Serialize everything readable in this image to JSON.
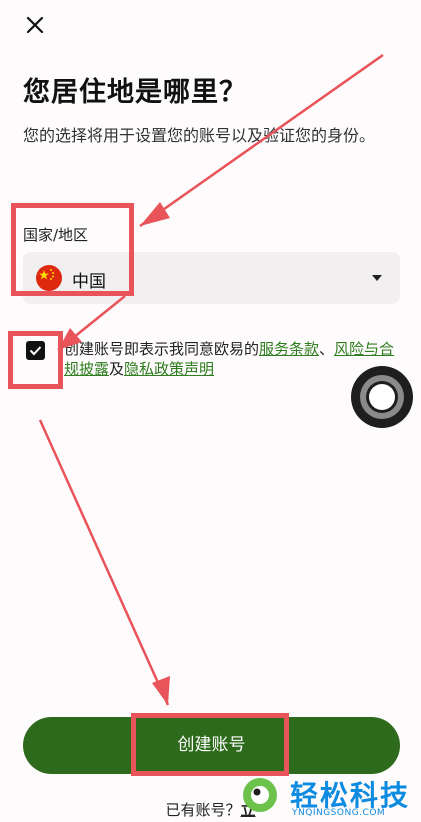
{
  "header": {
    "close_icon": "close-icon"
  },
  "title": "您居住地是哪里？",
  "subtitle": "您的选择将用于设置您的账号以及验证您的身份。",
  "country": {
    "label": "国家/地区",
    "selected": "中国",
    "flag_icon": "china-flag-icon",
    "dropdown_icon": "caret-down-icon"
  },
  "terms": {
    "checked": true,
    "prefix": "创建账号即表示我同意欧易的",
    "link_terms": "服务条款",
    "sep1": "、",
    "link_risk": "风险与合规披露",
    "sep2": "及",
    "link_privacy": "隐私政策声明"
  },
  "create_button": "创建账号",
  "login": {
    "prompt": "已有账号？",
    "link": "立"
  },
  "watermark": {
    "text": "轻松科技",
    "url": "YNQINGSONG.COM"
  },
  "colors": {
    "accent": "#2d6a1b",
    "link": "#2e7d1e",
    "annotation": "#e9545b",
    "watermark": "#0d8be0"
  }
}
